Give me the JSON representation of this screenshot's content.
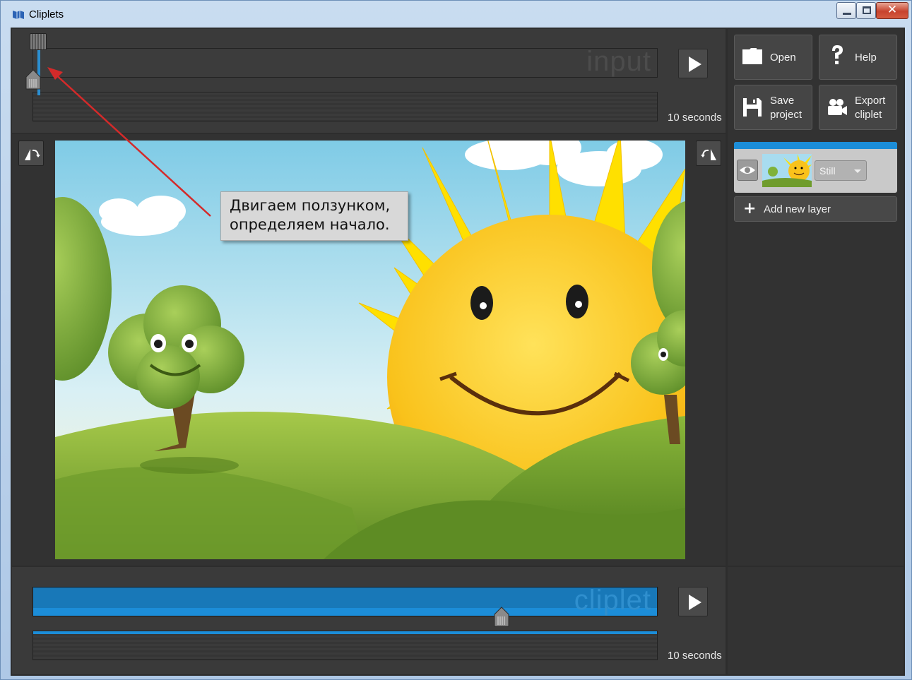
{
  "window": {
    "title": "Cliplets",
    "minimize_label": "",
    "maximize_label": "",
    "close_label": "✕"
  },
  "input_track": {
    "watermark": "input",
    "duration": "10 seconds"
  },
  "cliplet_track": {
    "watermark": "cliplet",
    "duration": "10 seconds"
  },
  "toolbar": {
    "open": "Open",
    "help": "Help",
    "save_line1": "Save",
    "save_line2": "project",
    "export_line1": "Export",
    "export_line2": "cliplet"
  },
  "layers": {
    "mode": "Still",
    "add_new_layer": "Add new layer"
  },
  "annotation": {
    "line1": "Двигаем ползунком,",
    "line2": "определяем начало."
  },
  "colors": {
    "accent": "#1c8dd8",
    "annotation_arrow": "#d42a2a"
  }
}
